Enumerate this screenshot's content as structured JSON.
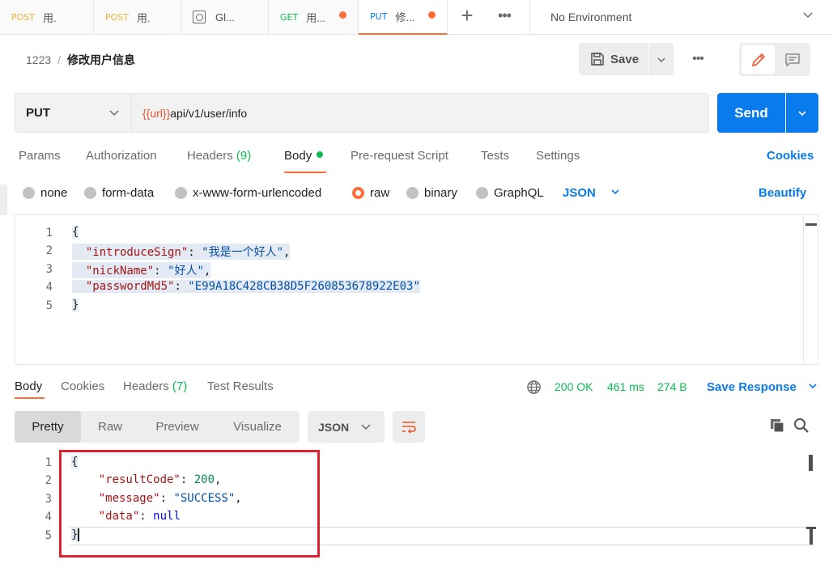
{
  "tabs": [
    {
      "method": "POST",
      "name": "用."
    },
    {
      "method": "POST",
      "name": "用."
    },
    {
      "method": "",
      "name": "Gl..."
    },
    {
      "method": "GET",
      "name": "用..."
    },
    {
      "method": "PUT",
      "name": "修..."
    }
  ],
  "environment": "No Environment",
  "breadcrumb": {
    "collection": "1223",
    "separator": "/",
    "request": "修改用户信息"
  },
  "toolbar": {
    "save_label": "Save"
  },
  "url_bar": {
    "method": "PUT",
    "url_var": "{{url}}",
    "url_path": "api/v1/user/info",
    "send_label": "Send"
  },
  "request_tabs": {
    "params": "Params",
    "authorization": "Authorization",
    "headers": "Headers",
    "headers_count": "(9)",
    "body": "Body",
    "pre_request": "Pre-request Script",
    "tests": "Tests",
    "settings": "Settings",
    "cookies": "Cookies"
  },
  "body_types": {
    "none": "none",
    "form_data": "form-data",
    "urlencoded": "x-www-form-urlencoded",
    "raw": "raw",
    "binary": "binary",
    "graphql": "GraphQL",
    "format": "JSON",
    "beautify": "Beautify"
  },
  "request_body": {
    "line_numbers": [
      "1",
      "2",
      "3",
      "4",
      "5"
    ],
    "open_brace": "{",
    "close_brace": "}",
    "key_introduce": "\"introduceSign\"",
    "val_introduce": "\"我是一个好人\"",
    "key_nick": "\"nickName\"",
    "val_nick": "\"好人\"",
    "key_pwd": "\"passwordMd5\"",
    "val_pwd": "\"E99A18C428CB38D5F260853678922E03\""
  },
  "response_tabs": {
    "body": "Body",
    "cookies": "Cookies",
    "headers": "Headers",
    "headers_count": "(7)",
    "test_results": "Test Results"
  },
  "response_meta": {
    "status": "200 OK",
    "time": "461 ms",
    "size": "274 B",
    "save_response": "Save Response"
  },
  "response_view": {
    "pretty": "Pretty",
    "raw": "Raw",
    "preview": "Preview",
    "visualize": "Visualize",
    "format": "JSON"
  },
  "response_body": {
    "line_numbers": [
      "1",
      "2",
      "3",
      "4",
      "5"
    ],
    "open_brace": "{",
    "close_brace": "}",
    "key_code": "\"resultCode\"",
    "val_code": "200",
    "key_msg": "\"message\"",
    "val_msg": "\"SUCCESS\"",
    "key_data": "\"data\"",
    "val_data": "null"
  },
  "colors": {
    "accent": "#ff6c37",
    "primary": "#097bed",
    "success": "#0cbb52",
    "annotation": "#e0242f"
  }
}
